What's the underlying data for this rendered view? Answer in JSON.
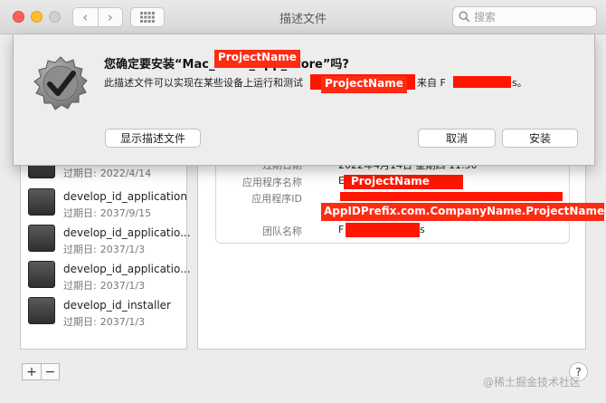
{
  "window": {
    "title": "描述文件"
  },
  "search": {
    "placeholder": "搜索"
  },
  "nav": {
    "back": "‹",
    "forward": "›"
  },
  "dialog": {
    "heading_prefix": "您确定要安装“Mac_",
    "heading_suffix": "_App_Store”吗?",
    "subtext_prefix": "此描述文件可以实现在某些设备上运行和测试",
    "subtext_from": "来自",
    "subtext_f": "F",
    "subtext_end": "s。",
    "show_button": "显示描述文件",
    "cancel_button": "取消",
    "install_button": "安装"
  },
  "tags": {
    "project_name_1": "ProjectName",
    "project_name_2": "ProjectName",
    "project_name_3": "ProjectName",
    "app_id": "AppIDPrefix.com.CompanyName.ProjectName"
  },
  "list": {
    "expiry_label": "过期日:",
    "items": [
      {
        "name": "",
        "expiry": "2022/4/14"
      },
      {
        "name": "develop_id_application",
        "expiry": "2037/9/15"
      },
      {
        "name": "develop_id_applicatio...",
        "expiry": "2037/1/3"
      },
      {
        "name": "develop_id_applicatio...",
        "expiry": "2037/1/3"
      },
      {
        "name": "develop_id_installer",
        "expiry": "2037/1/3"
      }
    ]
  },
  "detail": {
    "expired_label": "过期日期",
    "expired_value": "2022年4月14日 星期四 11:50",
    "app_name_label": "应用程序名称",
    "app_name_prefix": "E",
    "app_id_label": "应用程序ID",
    "team_label": "团队名称",
    "team_prefix": "F",
    "team_suffix": "s"
  },
  "toolbar": {
    "add": "+",
    "remove": "−"
  },
  "help": {
    "label": "?"
  },
  "watermark": {
    "text": "@稀土掘金技术社区"
  },
  "colors": {
    "redact": "#ff1600",
    "tag": "#ff2a12"
  }
}
